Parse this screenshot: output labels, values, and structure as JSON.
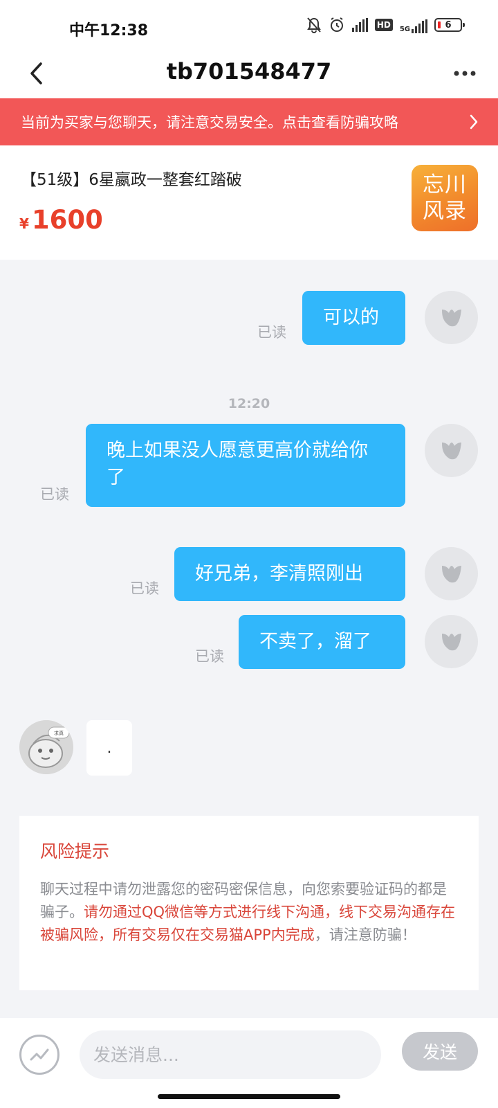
{
  "status_bar": {
    "time": "中午12:38",
    "battery": "6",
    "network": "5G",
    "hd": "HD",
    "icons": [
      "bell-off-icon",
      "alarm-icon",
      "signal-icon",
      "hd-icon",
      "signal-5g-icon",
      "battery-icon"
    ]
  },
  "header": {
    "title": "tb701548477",
    "back_icon": "chevron-left-icon",
    "more_icon": "more-dots-icon"
  },
  "banner": {
    "text": "当前为买家与您聊天，请注意交易安全。点击查看防骗攻略",
    "color": "#f25757"
  },
  "product": {
    "title": "【51级】6星嬴政一整套红踏破",
    "currency": "¥",
    "price": "1600",
    "logo_line1": "忘川",
    "logo_line2": "风录"
  },
  "chat": {
    "messages": [
      {
        "text": "可以的",
        "status": "已读"
      },
      {
        "text": "晚上如果没人愿意更高价就给你了",
        "status": "已读"
      },
      {
        "text": "好兄弟，李清照刚出",
        "status": "已读"
      },
      {
        "text": "不卖了，溜了",
        "status": "已读"
      }
    ],
    "time_separator": "12:20",
    "incoming_text": ".",
    "incoming_avatar_tag": "求真"
  },
  "risk": {
    "title": "风险提示",
    "body_gray_1": "聊天过程中请勿泄露您的密码密保信息，向您索要验证码的都是骗子。",
    "body_red": "请勿通过QQ微信等方式进行线下沟通，线下交易沟通存在被骗风险，所有交易仅在交易猫APP内完成",
    "body_gray_2": "，请注意防骗！"
  },
  "input": {
    "placeholder": "发送消息...",
    "send_label": "发送"
  },
  "colors": {
    "accent": "#31b7fb",
    "warning": "#d9463a",
    "price": "#e8402a"
  }
}
